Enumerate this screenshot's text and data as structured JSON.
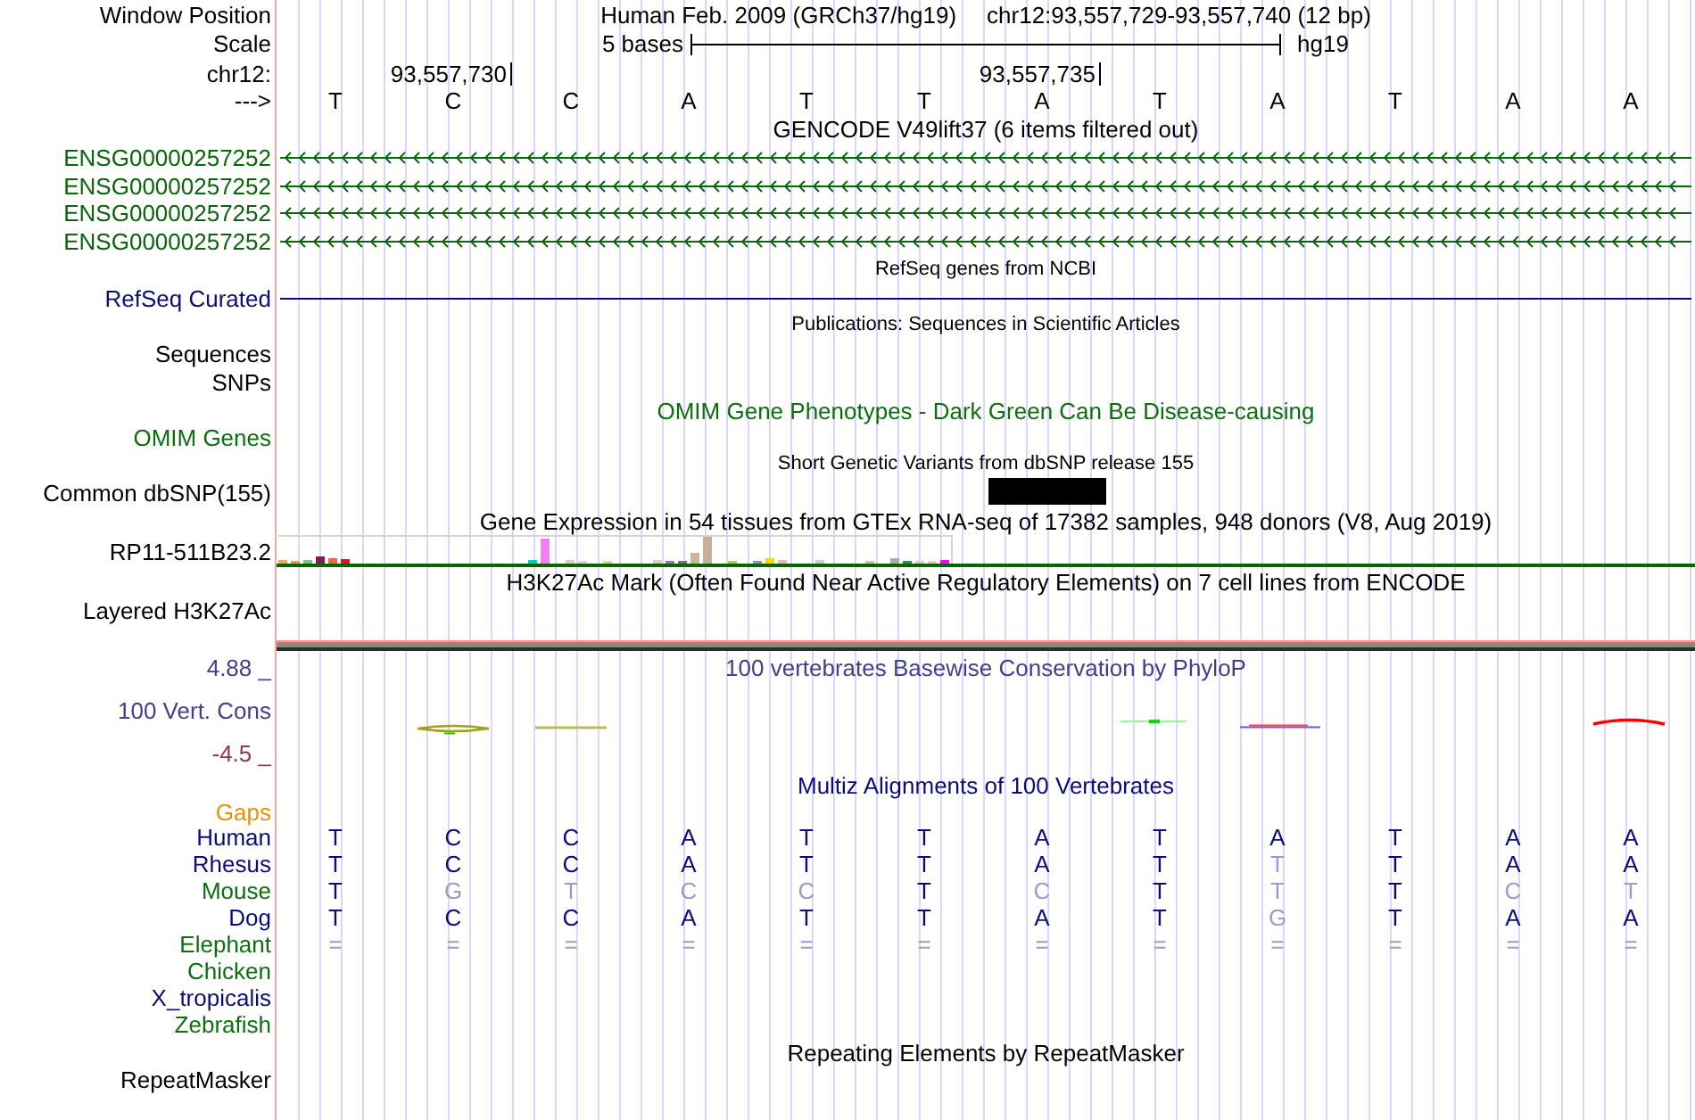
{
  "position": {
    "label": "Window Position",
    "assembly": "Human Feb. 2009 (GRCh37/hg19)",
    "range": "chr12:93,557,729-93,557,740 (12 bp)"
  },
  "scale": {
    "label": "Scale",
    "length": "5 bases",
    "assembly": "hg19"
  },
  "coordinates": {
    "label": "chr12:",
    "ticks": [
      "93,557,730",
      "93,557,735"
    ]
  },
  "sequence": {
    "label": "--->",
    "bases": [
      "T",
      "C",
      "C",
      "A",
      "T",
      "T",
      "A",
      "T",
      "A",
      "T",
      "A",
      "A"
    ]
  },
  "tracks": [
    {
      "kind": "genes",
      "title": "GENCODE V49lift37 (6 items filtered out)",
      "color": "#0c640c",
      "rows": [
        "ENSG00000257252",
        "ENSG00000257252",
        "ENSG00000257252",
        "ENSG00000257252"
      ]
    },
    {
      "kind": "line",
      "title": "RefSeq genes from NCBI",
      "color": "#0c0c78",
      "rows": [
        "RefSeq Curated"
      ]
    },
    {
      "kind": "sublabels",
      "title": "Publications: Sequences in Scientific Articles",
      "rows": [
        "Sequences",
        "SNPs"
      ]
    },
    {
      "kind": "plain",
      "title": "OMIM Gene Phenotypes - Dark Green Can Be Disease-causing",
      "color": "#0e6e0e",
      "rows": [
        "OMIM Genes"
      ]
    },
    {
      "kind": "snp",
      "title": "Short Genetic Variants from dbSNP release 155",
      "rows": [
        "Common dbSNP(155)"
      ]
    },
    {
      "kind": "expression",
      "title": "Gene Expression in 54 tissues from GTEx RNA-seq of 17382 samples, 948 donors (V8, Aug 2019)",
      "rows": [
        "RP11-511B23.2"
      ]
    },
    {
      "kind": "signal",
      "title": "H3K27Ac Mark (Often Found Near Active Regulatory Elements) on 7 cell lines from ENCODE",
      "rows": [
        "Layered H3K27Ac"
      ]
    },
    {
      "kind": "conservation",
      "title": "100 vertebrates Basewise Conservation by PhyloP",
      "color": "#40408c",
      "rows": [
        "100 Vert. Cons"
      ],
      "axis_max": "4.88 _",
      "axis_min": "-4.5 _"
    },
    {
      "kind": "alignment",
      "title": "Multiz Alignments of 100 Vertebrates",
      "color": "#0c0c78",
      "gaps": "Gaps",
      "species": [
        {
          "name": "Human",
          "color": "#0c0c78",
          "bases": [
            {
              "text": "T",
              "faded": false
            },
            {
              "text": "C",
              "faded": false
            },
            {
              "text": "C",
              "faded": false
            },
            {
              "text": "A",
              "faded": false
            },
            {
              "text": "T",
              "faded": false
            },
            {
              "text": "T",
              "faded": false
            },
            {
              "text": "A",
              "faded": false
            },
            {
              "text": "T",
              "faded": false
            },
            {
              "text": "A",
              "faded": false
            },
            {
              "text": "T",
              "faded": false
            },
            {
              "text": "A",
              "faded": false
            },
            {
              "text": "A",
              "faded": false
            }
          ]
        },
        {
          "name": "Rhesus",
          "color": "#0c0c78",
          "bases": [
            {
              "text": "T",
              "faded": false
            },
            {
              "text": "C",
              "faded": false
            },
            {
              "text": "C",
              "faded": false
            },
            {
              "text": "A",
              "faded": false
            },
            {
              "text": "T",
              "faded": false
            },
            {
              "text": "T",
              "faded": false
            },
            {
              "text": "A",
              "faded": false
            },
            {
              "text": "T",
              "faded": false
            },
            {
              "text": "T",
              "faded": true
            },
            {
              "text": "T",
              "faded": false
            },
            {
              "text": "A",
              "faded": false
            },
            {
              "text": "A",
              "faded": false
            }
          ]
        },
        {
          "name": "Mouse",
          "color": "#0e6e0e",
          "bases": [
            {
              "text": "T",
              "faded": false
            },
            {
              "text": "G",
              "faded": true
            },
            {
              "text": "T",
              "faded": true
            },
            {
              "text": "C",
              "faded": true
            },
            {
              "text": "C",
              "faded": true
            },
            {
              "text": "T",
              "faded": false
            },
            {
              "text": "C",
              "faded": true
            },
            {
              "text": "T",
              "faded": false
            },
            {
              "text": "T",
              "faded": true
            },
            {
              "text": "T",
              "faded": false
            },
            {
              "text": "C",
              "faded": true
            },
            {
              "text": "T",
              "faded": true
            }
          ]
        },
        {
          "name": "Dog",
          "color": "#0c0c78",
          "bases": [
            {
              "text": "T",
              "faded": false
            },
            {
              "text": "C",
              "faded": false
            },
            {
              "text": "C",
              "faded": false
            },
            {
              "text": "A",
              "faded": false
            },
            {
              "text": "T",
              "faded": false
            },
            {
              "text": "T",
              "faded": false
            },
            {
              "text": "A",
              "faded": false
            },
            {
              "text": "T",
              "faded": false
            },
            {
              "text": "G",
              "faded": true
            },
            {
              "text": "T",
              "faded": false
            },
            {
              "text": "A",
              "faded": false
            },
            {
              "text": "A",
              "faded": false
            }
          ]
        },
        {
          "name": "Elephant",
          "color": "#0e6e0e",
          "bases": [
            {
              "text": "=",
              "faded": true
            },
            {
              "text": "=",
              "faded": true
            },
            {
              "text": "=",
              "faded": true
            },
            {
              "text": "=",
              "faded": true
            },
            {
              "text": "=",
              "faded": true
            },
            {
              "text": "=",
              "faded": true
            },
            {
              "text": "=",
              "faded": true
            },
            {
              "text": "=",
              "faded": true
            },
            {
              "text": "=",
              "faded": true
            },
            {
              "text": "=",
              "faded": true
            },
            {
              "text": "=",
              "faded": true
            },
            {
              "text": "=",
              "faded": true
            }
          ]
        },
        {
          "name": "Chicken",
          "color": "#0e6e0e"
        },
        {
          "name": "X_tropicalis",
          "color": "#0c0c78"
        },
        {
          "name": "Zebrafish",
          "color": "#0e6e0e"
        }
      ]
    },
    {
      "kind": "repeats",
      "title": "Repeating Elements by RepeatMasker",
      "rows": [
        "RepeatMasker"
      ]
    }
  ]
}
